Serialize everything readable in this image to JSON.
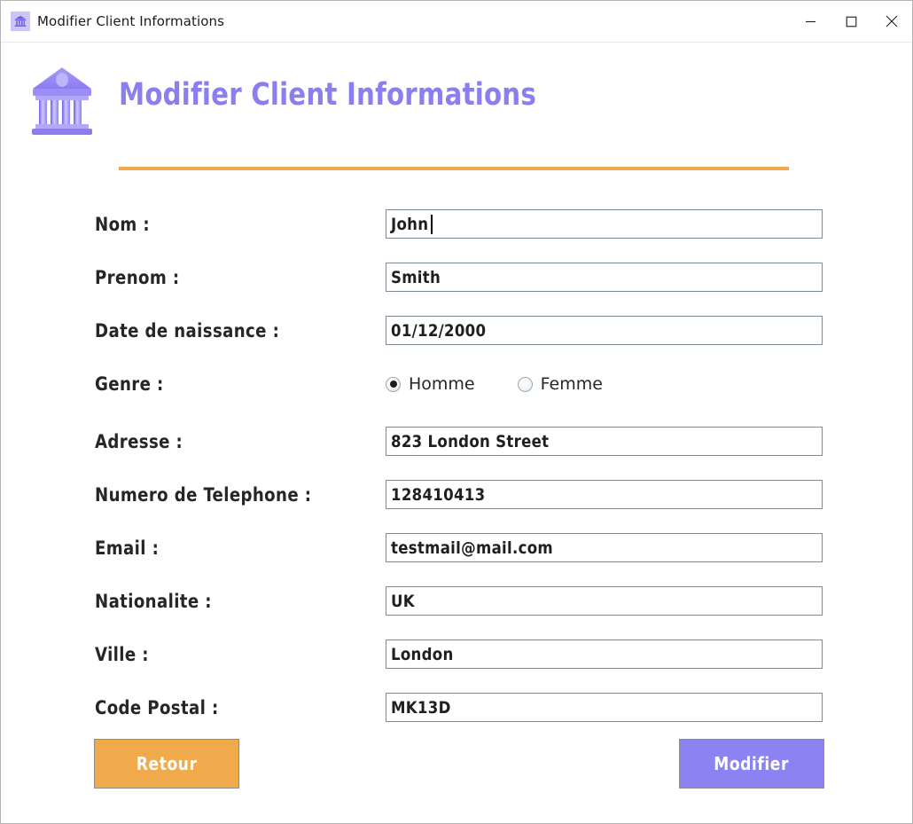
{
  "window": {
    "title": "Modifier Client Informations",
    "icon": "bank-building-icon",
    "controls": {
      "minimize": "minimize-button",
      "maximize": "maximize-button",
      "close": "close-button"
    }
  },
  "header": {
    "icon": "bank-building-icon",
    "title": "Modifier Client Informations",
    "rule_color": "#f0a94b",
    "title_color": "#8b7ef0"
  },
  "form": {
    "fields": [
      {
        "label": "Nom :",
        "value": "John",
        "name": "nom",
        "focused": true
      },
      {
        "label": "Prenom :",
        "value": "Smith",
        "name": "prenom",
        "focused": false
      },
      {
        "label": "Date de naissance :",
        "value": "01/12/2000",
        "name": "date-naissance",
        "focused": false
      },
      {
        "label": "Adresse :",
        "value": "823 London Street",
        "name": "adresse",
        "focused": false
      },
      {
        "label": "Numero de Telephone :",
        "value": "128410413",
        "name": "telephone",
        "focused": false
      },
      {
        "label": "Email :",
        "value": "testmail@mail.com",
        "name": "email",
        "focused": false
      },
      {
        "label": "Nationalite :",
        "value": "UK",
        "name": "nationalite",
        "focused": false
      },
      {
        "label": "Ville :",
        "value": "London",
        "name": "ville",
        "focused": false
      },
      {
        "label": "Code Postal :",
        "value": "MK13D",
        "name": "code-postal",
        "focused": false
      }
    ],
    "genre": {
      "label": "Genre :",
      "options": [
        {
          "label": "Homme",
          "selected": true
        },
        {
          "label": "Femme",
          "selected": false
        }
      ]
    }
  },
  "buttons": {
    "back": {
      "label": "Retour",
      "color": "#f0a94b"
    },
    "submit": {
      "label": "Modifier",
      "color": "#8c82f2"
    }
  }
}
